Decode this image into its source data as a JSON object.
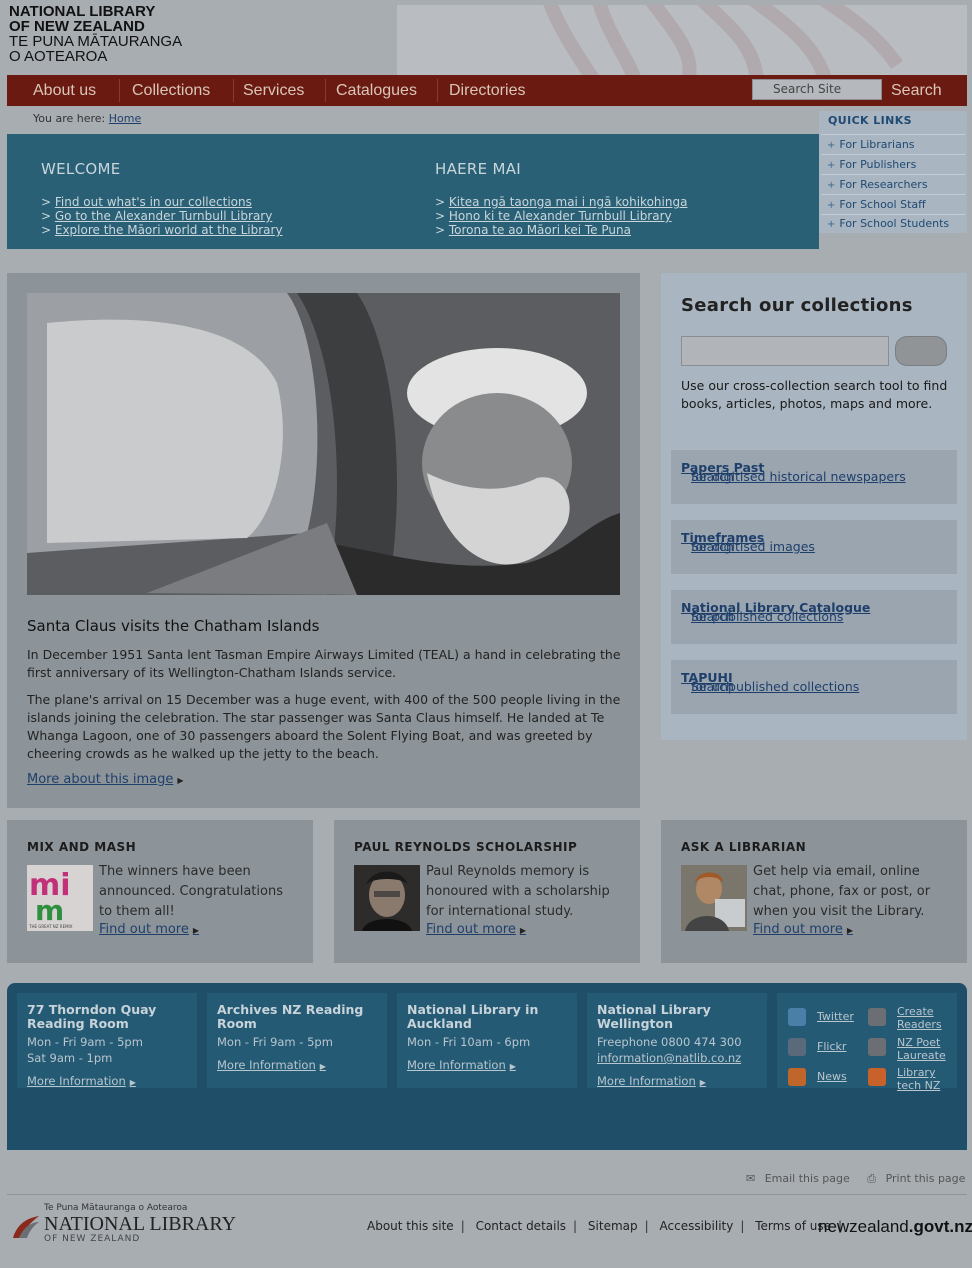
{
  "header": {
    "logo_line1": "NATIONAL LIBRARY",
    "logo_line2": "OF NEW ZEALAND",
    "logo_line3": "TE PUNA MĀTAURANGA",
    "logo_line4": "O AOTEAROA"
  },
  "nav": {
    "items": [
      "About us",
      "Collections",
      "Services",
      "Catalogues",
      "Directories"
    ],
    "search_placeholder": "Search Site",
    "search_label": "Search"
  },
  "breadcrumb": {
    "prefix": "You are here:",
    "home": "Home"
  },
  "welcome": {
    "title_en": "WELCOME",
    "title_mi": "HAERE MAI",
    "links_en": [
      "Find out what's in our collections",
      "Go to the Alexander Turnbull Library",
      "Explore the Māori world at the Library"
    ],
    "links_mi": [
      "Kitea ngā taonga mai i ngā kohikohinga",
      "Hono ki te Alexander Turnbull Library",
      "Torona te ao Māori kei Te Puna"
    ]
  },
  "quick_links": {
    "title": "QUICK LINKS",
    "items": [
      "For Librarians",
      "For Publishers",
      "For Researchers",
      "For School Staff",
      "For School Students"
    ]
  },
  "feature": {
    "title": "Santa Claus visits the Chatham Islands",
    "para1": "In December 1951 Santa lent Tasman Empire Airways Limited (TEAL) a hand in celebrating the first anniversary of its Wellington-Chatham Islands service.",
    "para2": "The plane's arrival on 15 December was a huge event, with 400 of the 500 people living in the islands joining the celebration. The star passenger was Santa Claus himself. He landed at Te Whanga Lagoon, one of 30 passengers aboard the Solent Flying Boat, and was greeted by cheering crowds as he walked up the jetty to the beach.",
    "more": "More about this image"
  },
  "search_panel": {
    "title": "Search our collections",
    "description": "Use our cross-collection search tool to find books, articles, photos, maps and more.",
    "links": [
      {
        "pre": "Search ",
        "strong": "Papers Past",
        "post": " for digitised historical newspapers"
      },
      {
        "pre": "Search ",
        "strong": "Timeframes",
        "post": " for digitised images"
      },
      {
        "pre": "Search ",
        "strong": "National Library Catalogue",
        "post": " for published collections"
      },
      {
        "pre": "Search ",
        "strong": "TAPUHI",
        "post": " for unpublished collections"
      }
    ]
  },
  "promos": [
    {
      "title": "MIX AND MASH",
      "text": "The winners have been announced. Congratulations to them all!",
      "more": "Find out more",
      "img_text": "THE GREAT NZ REMIX"
    },
    {
      "title": "PAUL REYNOLDS SCHOLARSHIP",
      "text": "Paul Reynolds memory is honoured with a scholarship for international study.",
      "more": "Find out more"
    },
    {
      "title": "ASK A LIBRARIAN",
      "text": "Get help via email, online chat, phone, fax or post, or when you visit the Library.",
      "more": "Find out more"
    }
  ],
  "footer": {
    "cols": [
      {
        "title": "77 Thorndon Quay Reading Room",
        "lines": [
          "Mon - Fri 9am - 5pm",
          "Sat 9am - 1pm"
        ],
        "more": "More Information"
      },
      {
        "title": "Archives NZ Reading Room",
        "lines": [
          "Mon - Fri 9am - 5pm"
        ],
        "more": "More Information"
      },
      {
        "title": "National Library in Auckland",
        "lines": [
          "Mon - Fri 10am - 6pm"
        ],
        "more": "More Information"
      },
      {
        "title": "National Library Wellington",
        "lines": [
          "Freephone 0800 474 300",
          "information@natlib.co.nz"
        ],
        "more": "More Information"
      }
    ],
    "social": [
      "Twitter",
      "Flickr",
      "News"
    ],
    "social2": [
      "Create Readers",
      "NZ Poet Laureate",
      "Library tech NZ"
    ],
    "social_colors": {
      "twitter": "#4a7fa8",
      "flickr": "#7a4a8a",
      "news": "#c0662a",
      "create": "#6b6f74",
      "poet": "#6b6f74",
      "blogger": "#c8622a"
    }
  },
  "utility": {
    "email": "Email this page",
    "print": "Print this page"
  },
  "bottom": {
    "small": "Te Puna Mātauranga o Aotearoa",
    "logo": "NATIONAL LIBRARY",
    "sub": "OF NEW ZEALAND",
    "links": [
      "About this site",
      "Contact details",
      "Sitemap",
      "Accessibility",
      "Terms of use"
    ],
    "nzgovt_a": "newzealand",
    "nzgovt_b": ".govt.nz"
  }
}
